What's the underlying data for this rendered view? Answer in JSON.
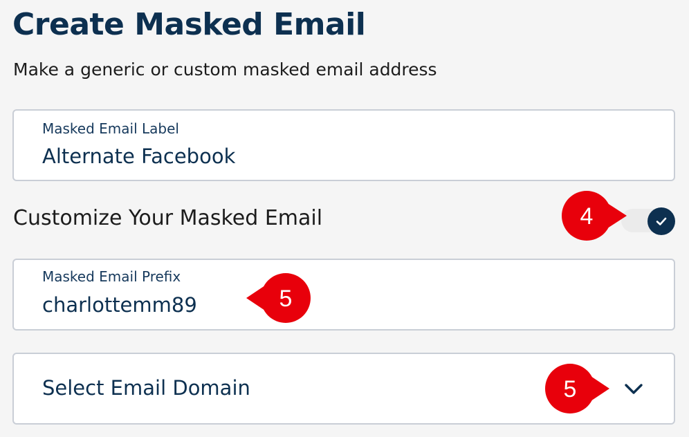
{
  "page": {
    "title": "Create Masked Email",
    "subtitle": "Make a generic or custom masked email address"
  },
  "form": {
    "label_field": {
      "label": "Masked Email Label",
      "value": "Alternate Facebook"
    },
    "customize": {
      "label": "Customize Your Masked Email",
      "toggle_on": true,
      "toggle_icon": "check-icon"
    },
    "prefix_field": {
      "label": "Masked Email Prefix",
      "value": "charlottemm89"
    },
    "domain_select": {
      "placeholder": "Select Email Domain",
      "icon": "chevron-down-icon"
    }
  },
  "annotations": {
    "toggle_step": "4",
    "prefix_step": "5",
    "domain_step": "5",
    "color": "#e8000b"
  },
  "colors": {
    "primary": "#0d3050",
    "border": "#c9ced6",
    "background": "#f5f5f5"
  }
}
